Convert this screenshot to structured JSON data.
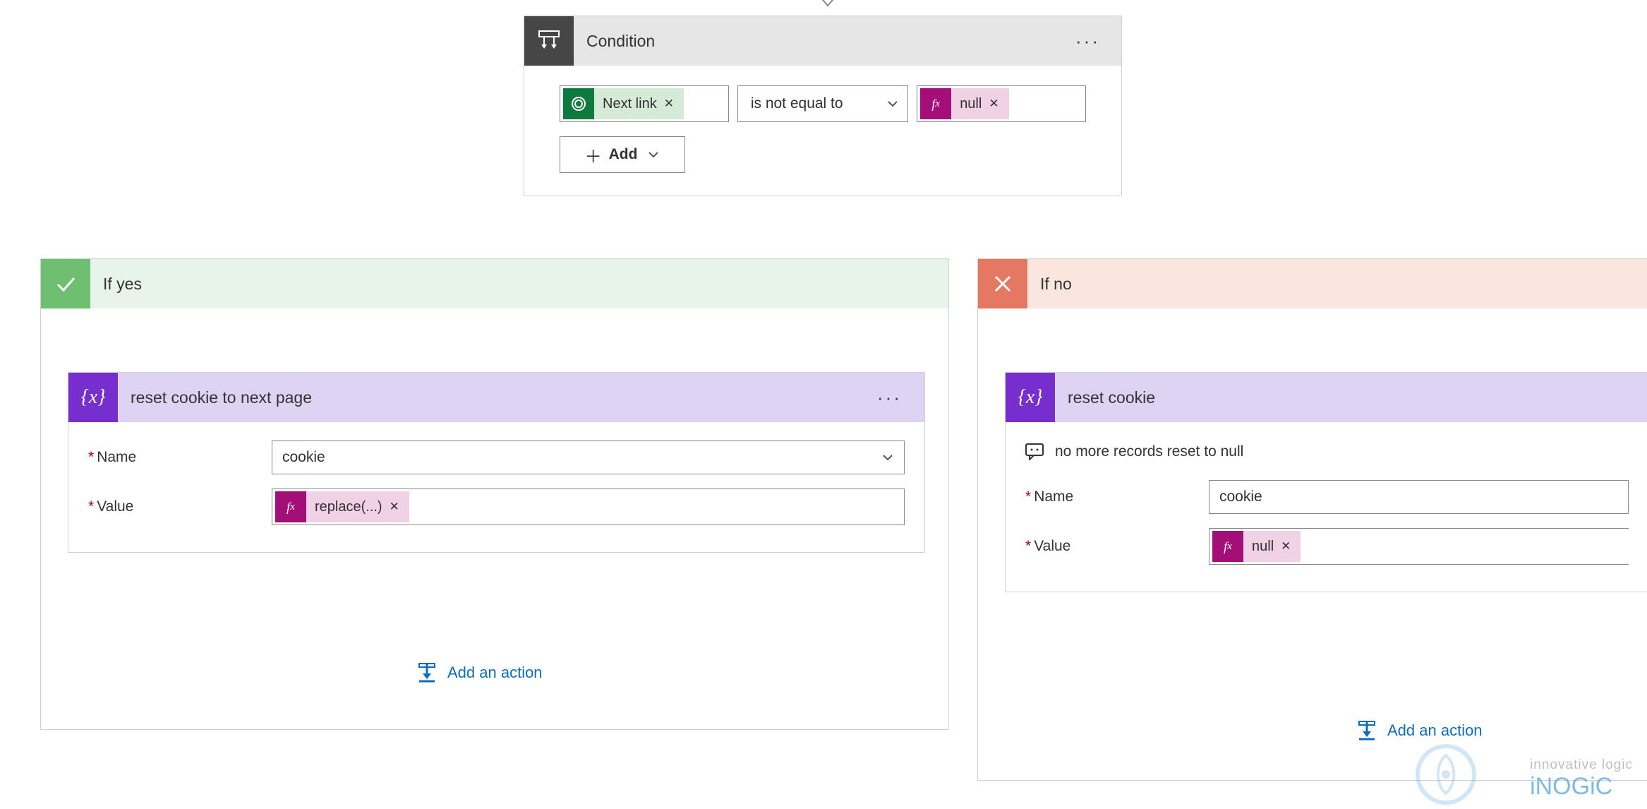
{
  "condition": {
    "title": "Condition",
    "left_token_label": "Next link",
    "operator": "is not equal to",
    "right_token_label": "null",
    "add_button_label": "Add"
  },
  "if_yes": {
    "title": "If yes",
    "action": {
      "title": "reset cookie to next page",
      "fields": {
        "name_label": "Name",
        "name_value": "cookie",
        "value_label": "Value",
        "value_token": "replace(...)"
      }
    },
    "add_action_label": "Add an action"
  },
  "if_no": {
    "title": "If no",
    "action": {
      "title": "reset cookie",
      "comment": "no more records reset to null",
      "fields": {
        "name_label": "Name",
        "name_value": "cookie",
        "value_label": "Value",
        "value_token": "null"
      }
    },
    "add_action_label": "Add an action"
  },
  "watermark": {
    "tagline": "innovative logic",
    "brand": "iNOGiC"
  }
}
